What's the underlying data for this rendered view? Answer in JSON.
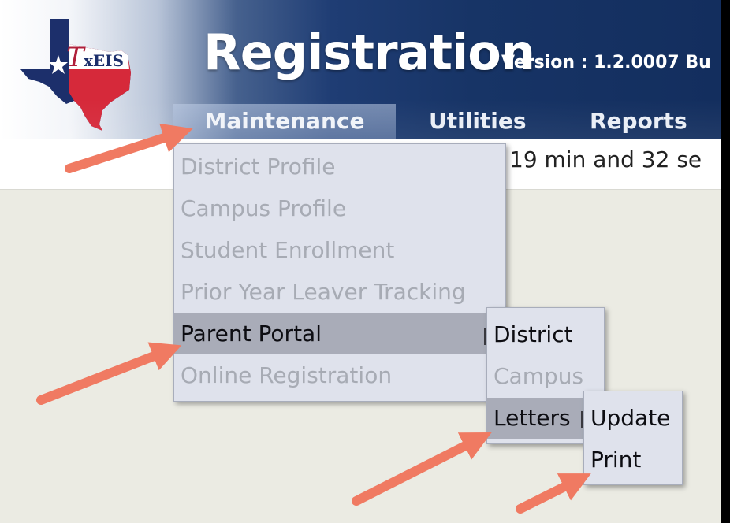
{
  "header": {
    "logo_text": "TxEIS",
    "app_title": "Registration",
    "version": "Version : 1.2.0007 Bu"
  },
  "nav": {
    "items": [
      {
        "label": "Maintenance"
      },
      {
        "label": "Utilities"
      },
      {
        "label": "Reports"
      }
    ]
  },
  "session": {
    "text": "19 min and 32 se"
  },
  "maintenance_menu": {
    "items": [
      {
        "label": "District Profile",
        "enabled": false
      },
      {
        "label": "Campus Profile",
        "enabled": false
      },
      {
        "label": "Student Enrollment",
        "enabled": false
      },
      {
        "label": "Prior Year Leaver Tracking",
        "enabled": false
      },
      {
        "label": "Parent Portal",
        "enabled": true,
        "selected": true
      },
      {
        "label": "Online Registration",
        "enabled": false
      }
    ]
  },
  "parent_portal_menu": {
    "items": [
      {
        "label": "District",
        "enabled": true
      },
      {
        "label": "Campus",
        "enabled": false
      },
      {
        "label": "Letters",
        "enabled": true,
        "selected": true
      }
    ]
  },
  "letters_menu": {
    "items": [
      {
        "label": "Update",
        "enabled": true
      },
      {
        "label": "Print",
        "enabled": true
      }
    ]
  },
  "colors": {
    "header_dark": "#173466",
    "arrow": "#f07a62",
    "menu_bg": "#dfe2ec",
    "menu_selected": "#a9acb8",
    "disabled_text": "#a7abb4"
  }
}
